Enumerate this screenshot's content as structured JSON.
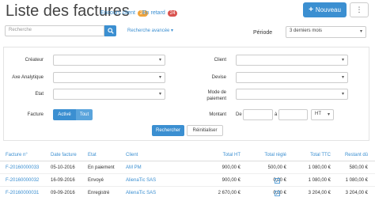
{
  "header": {
    "title": "Liste des factures",
    "encours_label": "Encours client",
    "encours_count": "24",
    "retard_label": "En retard",
    "retard_count": "24",
    "new_button": "Nouveau",
    "more_glyph": "⋮"
  },
  "search": {
    "placeholder": "Recherche",
    "advanced_link": "Recherche avancée",
    "periode_label": "Période",
    "periode_value": "3 derniers mois"
  },
  "filters": {
    "createur_label": "Créateur",
    "axe_label": "Axe Analytique",
    "etat_label": "Etat",
    "facture_label": "Facture",
    "active_label": "Activé",
    "tout_label": "Tout",
    "client_label": "Client",
    "devise_label": "Devise",
    "mode_label_1": "Mode de",
    "mode_label_2": "paiement",
    "montant_label": "Montant",
    "de_label": "De",
    "a_label": "à",
    "ht_value": "HT",
    "search_button": "Rechercher",
    "reset_button": "Réinitialiser"
  },
  "table": {
    "columns": [
      "Facture n°",
      "Date facture",
      "Etat",
      "Client",
      "Total HT",
      "Total réglé",
      "Total TTC",
      "Restant dû"
    ],
    "rows": [
      {
        "num": "F-20160000033",
        "date": "05-10-2016",
        "etat": "En paiement",
        "client": "AM PM",
        "ht": "900,00 €",
        "regle": "500,00 €",
        "ttc": "1 080,00 €",
        "restant": "580,00 €"
      },
      {
        "num": "F-20160000032",
        "date": "16-09-2016",
        "etat": "Envoyé",
        "client": "AlienaTic SAS",
        "ht": "900,00 €",
        "regle": "0,00 €",
        "ttc": "1 080,00 €",
        "restant": "1 080,00 €"
      },
      {
        "num": "F-20160000031",
        "date": "09-09-2016",
        "etat": "Enregistré",
        "client": "AlienaTic SAS",
        "ht": "2 670,00 €",
        "regle": "0,00 €",
        "ttc": "3 204,00 €",
        "restant": "3 204,00 €"
      }
    ]
  },
  "colors": {
    "accent": "#3b8fd1",
    "badge_orange": "#f0a33a",
    "badge_red": "#d9534f"
  }
}
